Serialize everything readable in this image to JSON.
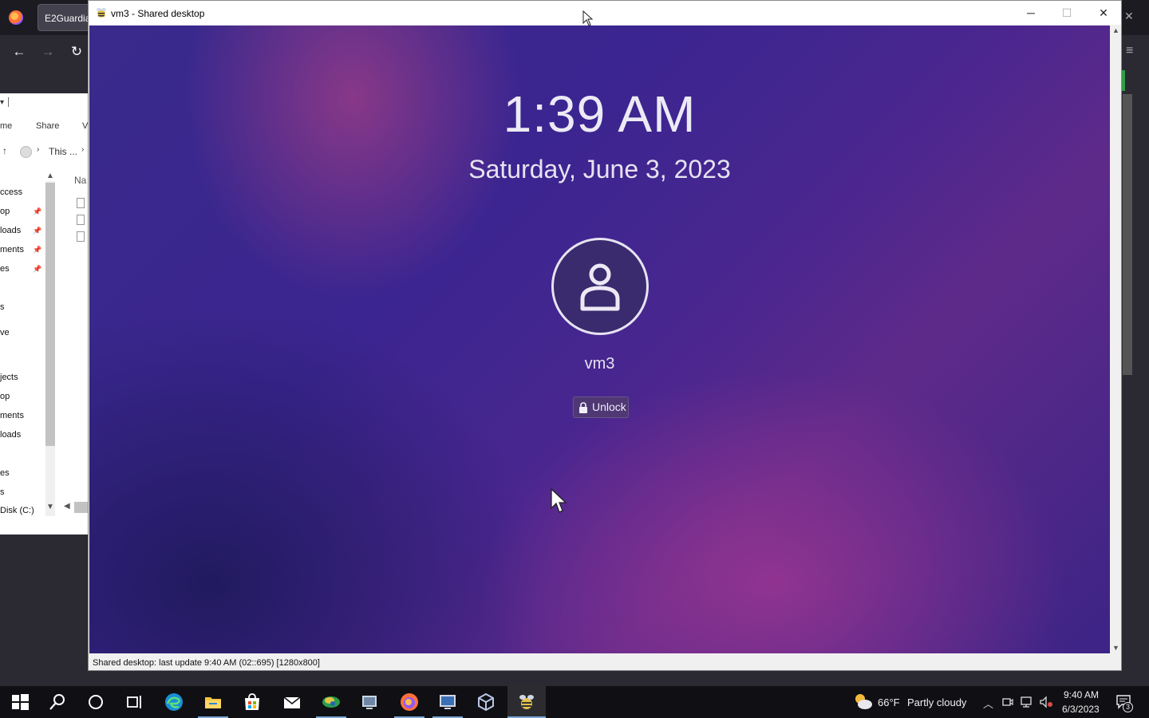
{
  "background_browser": {
    "tab_title": "E2Guardia",
    "nav": {
      "back": "←",
      "forward": "→",
      "reload": "↻"
    },
    "close": "✕",
    "menu": "≡"
  },
  "file_explorer": {
    "ribbon": [
      "me",
      "Share",
      "V"
    ],
    "address": {
      "crumb": "This ...",
      "sep": "›"
    },
    "column_header": "Na",
    "nav_items": [
      {
        "label": "ccess",
        "pinned": false
      },
      {
        "label": "op",
        "pinned": true
      },
      {
        "label": "loads",
        "pinned": true
      },
      {
        "label": "ments",
        "pinned": true
      },
      {
        "label": "es",
        "pinned": true
      },
      {
        "label": "",
        "pinned": false
      },
      {
        "label": "s",
        "pinned": false
      },
      {
        "label": "ve",
        "pinned": false
      },
      {
        "label": "jects",
        "pinned": false
      },
      {
        "label": "op",
        "pinned": false
      },
      {
        "label": "ments",
        "pinned": false
      },
      {
        "label": "loads",
        "pinned": false
      },
      {
        "label": "",
        "pinned": false
      },
      {
        "label": "es",
        "pinned": false
      },
      {
        "label": "s",
        "pinned": false
      },
      {
        "label": "Disk (C:)",
        "pinned": false
      }
    ]
  },
  "vm_window": {
    "title": "vm3 - Shared desktop",
    "controls": {
      "minimize": "─",
      "maximize": "☐",
      "close": "✕"
    },
    "status_bar": "Shared desktop: last update 9:40 AM (02::695) [1280x800]"
  },
  "lock_screen": {
    "time": "1:39 AM",
    "date": "Saturday, June 3, 2023",
    "username": "vm3",
    "unlock_label": "Unlock"
  },
  "taskbar": {
    "apps": [
      {
        "name": "start-icon",
        "active": false
      },
      {
        "name": "search-icon",
        "active": false
      },
      {
        "name": "cortana-icon",
        "active": false
      },
      {
        "name": "task-view-icon",
        "active": false
      },
      {
        "name": "edge-icon",
        "active": false
      },
      {
        "name": "file-explorer-icon",
        "active": true
      },
      {
        "name": "store-icon",
        "active": false
      },
      {
        "name": "mail-icon",
        "active": false
      },
      {
        "name": "network-app-icon",
        "active": true
      },
      {
        "name": "remote-app-icon",
        "active": false
      },
      {
        "name": "firefox-icon",
        "active": true
      },
      {
        "name": "rdp-icon",
        "active": true
      },
      {
        "name": "virtualbox-icon",
        "active": false
      },
      {
        "name": "vm-viewer-icon",
        "active": true
      }
    ],
    "weather": {
      "temperature": "66°F",
      "condition": "Partly cloudy"
    },
    "clock": {
      "time": "9:40 AM",
      "date": "6/3/2023"
    },
    "notification_count": "3"
  },
  "colors": {
    "taskbar_bg": "#101014",
    "lock_text": "#eceaf5",
    "accent_underline": "#7aa7d6"
  }
}
